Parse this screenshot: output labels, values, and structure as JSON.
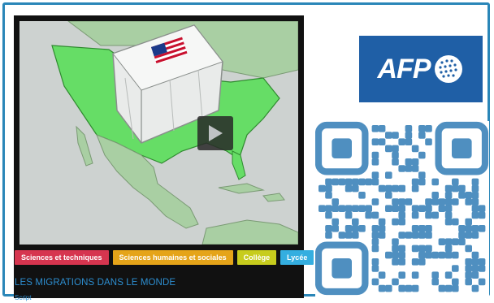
{
  "tags": [
    {
      "label": "Sciences et techniques",
      "color": "#d6354f"
    },
    {
      "label": "Sciences humaines et sociales",
      "color": "#e5a419"
    },
    {
      "label": "Collège",
      "color": "#c7cc1d"
    },
    {
      "label": "Lycée",
      "color": "#34aee0"
    }
  ],
  "video": {
    "title": "LES MIGRATIONS DANS LE MONDE",
    "script_link": "Script"
  },
  "logo": {
    "text": "AFP",
    "color": "#1f5fa6"
  },
  "qr": {
    "color": "#4f8fc0"
  },
  "colors": {
    "frame": "#2a86b8",
    "land_highlight": "#66dd66",
    "land": "#a9cfa3",
    "ocean": "#cdd2d0"
  }
}
